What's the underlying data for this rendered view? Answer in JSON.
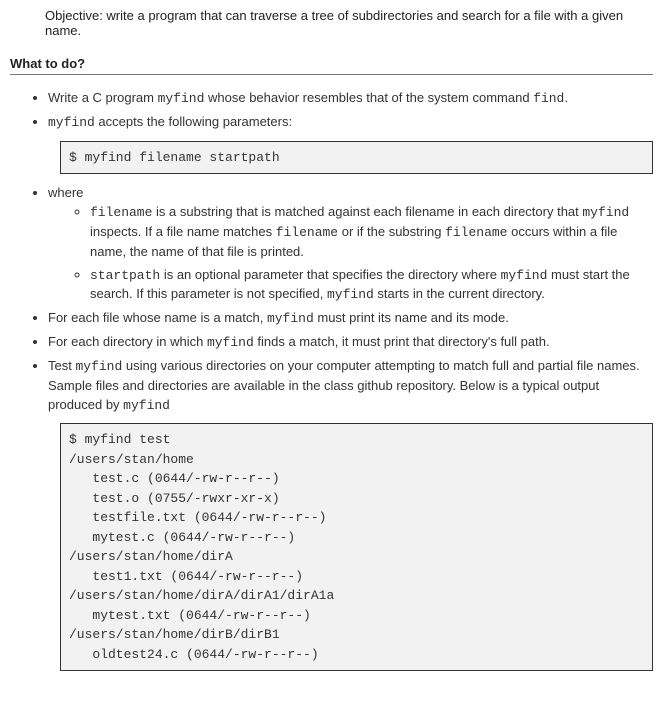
{
  "objective": "Objective: write a program that can traverse a tree of subdirectories and search for a file with a given name.",
  "section_header": "What to do?",
  "bullets": {
    "b1_pre": "Write a C program ",
    "b1_code1": "myfind",
    "b1_mid": " whose behavior resembles that of the system command ",
    "b1_code2": "find",
    "b1_post": ".",
    "b2_pre": "",
    "b2_code": "myfind",
    "b2_post": " accepts the following parameters:",
    "usage_box": "$ myfind filename startpath",
    "b3": "where",
    "sub1_code1": "filename",
    "sub1_t1": " is a substring that is matched against each filename in each directory that ",
    "sub1_code2": "myfind",
    "sub1_t2": " inspects. If a file name matches ",
    "sub1_code3": "filename",
    "sub1_t3": " or if the substring ",
    "sub1_code4": "filename",
    "sub1_t4": " occurs within a file name, the name of that file is printed.",
    "sub2_code1": "startpath",
    "sub2_t1": " is an optional parameter that specifies the directory where ",
    "sub2_code2": "myfind",
    "sub2_t2": " must start the search. If this parameter is not specified, ",
    "sub2_code3": "myfind",
    "sub2_t3": " starts in the current directory.",
    "b4_t1": "For each file whose name is a match, ",
    "b4_code": "myfind",
    "b4_t2": " must print its name and its mode.",
    "b5_t1": "For each directory in which ",
    "b5_code": "myfind",
    "b5_t2": " finds a match, it must print that directory's full path.",
    "b6_t1": "Test ",
    "b6_code1": "myfind",
    "b6_t2": " using various directories on your computer attempting to match full and partial file names. Sample files and directories are available in the class github repository. Below is a typical output produced by ",
    "b6_code2": "myfind",
    "output_box": "$ myfind test\n/users/stan/home\n   test.c (0644/-rw-r--r--)\n   test.o (0755/-rwxr-xr-x)\n   testfile.txt (0644/-rw-r--r--)\n   mytest.c (0644/-rw-r--r--)\n/users/stan/home/dirA\n   test1.txt (0644/-rw-r--r--)\n/users/stan/home/dirA/dirA1/dirA1a\n   mytest.txt (0644/-rw-r--r--)\n/users/stan/home/dirB/dirB1\n   oldtest24.c (0644/-rw-r--r--)"
  }
}
